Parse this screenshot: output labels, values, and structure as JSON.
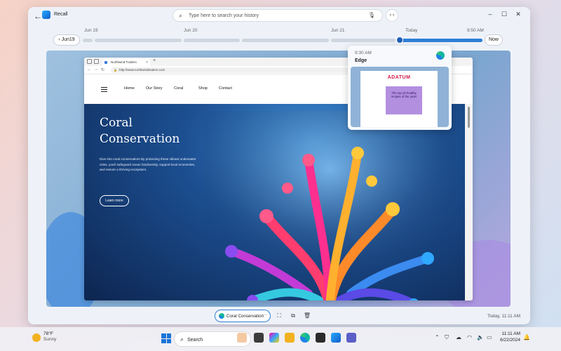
{
  "window": {
    "app_title": "Recall",
    "search_placeholder": "Type here to search your history"
  },
  "timeline": {
    "labels": [
      "Jun 19",
      "Jun 20",
      "Jun 21",
      "Today",
      "9:50 AM"
    ],
    "current_button": "Jun19",
    "now_button": "Now"
  },
  "snapshot": {
    "browser": {
      "tab_title": "Northwind Traders",
      "url": "http://www.northwindtraders.com",
      "nav": [
        "Home",
        "Our Story",
        "Coral",
        "Shop",
        "Contact"
      ],
      "hero_title": "Coral Conservation",
      "hero_body": "Dive into coral conservation! By protecting these vibrant underwater cities, you'll safeguard ocean biodiversity, support local economies, and ensure a thriving ecosystem.",
      "cta": "Learn more"
    }
  },
  "preview": {
    "time": "9:30 AM",
    "app": "Edge",
    "brand": "ADATUM",
    "card_text": "The top 25 healthy recipes of the year!"
  },
  "bottom_bar": {
    "chip_label": "Coral Conservation",
    "timestamp": "Today, 11:11 AM"
  },
  "taskbar": {
    "temp": "78°F",
    "condition": "Sunny",
    "search_label": "Search",
    "time": "11:11 AM",
    "date": "6/22/2024"
  },
  "colors": {
    "accent": "#2f7fd6",
    "brand": "#d11a4a"
  }
}
